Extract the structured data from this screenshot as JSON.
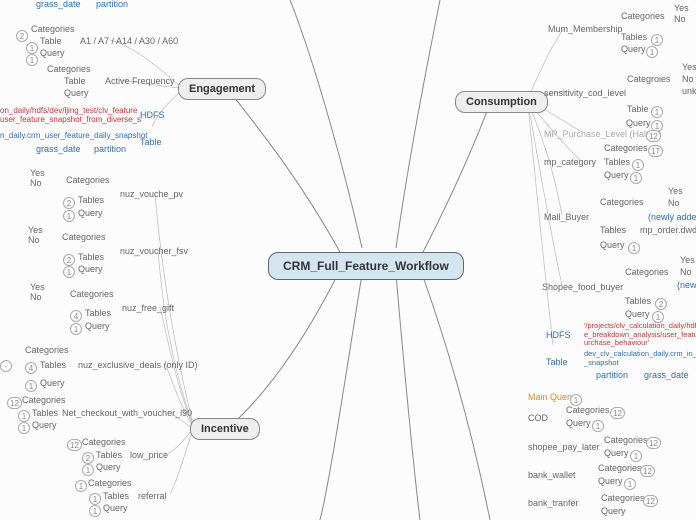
{
  "center": {
    "title": "CRM_Full_Feature_Workflow"
  },
  "left_top": {
    "grass_date": "grass_date",
    "partition": "partition",
    "categories_a": "Categories",
    "table_a": "Table",
    "query_a": "Query",
    "a_line": "A1 / A7 / A14 / A30 / A60",
    "categories_b": "Categories",
    "table_b": "Table",
    "query_b": "Query",
    "active_freq": "Active Frequency",
    "hdfs": "HDFS",
    "hdfs_path": "on_daily/hdfs/dev/ljing_test/clv_feature\nuser_feature_snapshot_from_diverse_s",
    "table_label": "Table",
    "table_path": "n_daily.crm_user_feature_daily_snapshot",
    "grass_date2": "grass_date",
    "partition2": "partition",
    "badge_2": "2",
    "badge_1a": "1",
    "badge_1b": "1"
  },
  "engagement": {
    "label": "Engagement"
  },
  "incentive": {
    "label": "Incentive"
  },
  "consumption": {
    "label": "Consumption"
  },
  "incentive_children": {
    "yes1": "Yes",
    "no1": "No",
    "cat1": "Categories",
    "tab1": "Tables",
    "q1": "Query",
    "b1a": "2",
    "b1b": "1",
    "node1": "nuz_vouche_pv",
    "yes2": "Yes",
    "no2": "No",
    "cat2": "Categories",
    "tab2": "Tables",
    "q2": "Query",
    "b2a": "2",
    "b2b": "1",
    "node2": "nuz_voucher_fsv",
    "yes3": "Yes",
    "no3": "No",
    "cat3": "Categories",
    "tab3": "Tables",
    "q3": "Query",
    "b3a": "4",
    "b3b": "1",
    "node3": "nuz_free_gift",
    "cat4": "Categories",
    "tab4": "Tables",
    "q4": "Query",
    "b4a": "4",
    "b4b": "1",
    "node4": "nuz_exclusive_deals (only ID)",
    "cat5": "Categories",
    "tab5": "Tables",
    "q5": "Query",
    "b5a": "12",
    "b5b": "1",
    "b5c": "1",
    "node5": "Net_checkout_with_voucher_l90",
    "cat6": "Categories",
    "tab6": "Tables",
    "q6": "Query",
    "b6a": "12",
    "b6b": "2",
    "b6c": "1",
    "node6": "low_price",
    "cat7": "Categories",
    "tab7": "Tables",
    "q7": "Query",
    "b7a": "1",
    "b7b": "1",
    "b7c": "1",
    "node7": "referral"
  },
  "consumption_children": {
    "mum": "Mum_Membership",
    "mum_cat": "Categories",
    "mum_tab": "Tables",
    "mum_q": "Query",
    "mum_yes": "Yes",
    "mum_no": "No",
    "mum_b1": "1",
    "mum_b2": "1",
    "scl": "sensitivity_cod_level",
    "scl_cat": "Categroies",
    "scl_tab": "Table",
    "scl_q": "Query",
    "scl_yes": "Yes",
    "scl_no": "No",
    "scl_unk": "unk",
    "scl_b1": "1",
    "scl_b2": "1",
    "halted": "MP_Purchase_Level (Halted)",
    "halted_b": "12",
    "mpcat": "mp_category",
    "mpcat_cat": "Categories",
    "mpcat_tab": "Tables",
    "mpcat_q": "Query",
    "mpcat_b1": "17",
    "mpcat_b2": "1",
    "mpcat_b3": "1",
    "mall": "Mall_Buyer",
    "mall_cat": "Categories",
    "mall_tab": "Tables",
    "mall_q": "Query",
    "mall_yes": "Yes",
    "mall_no": "No",
    "mall_new": "(newly added",
    "mall_tabval": "mp_order.dwd_orc",
    "mall_b": "1",
    "food": "Shopee_food_buyer",
    "food_cat": "Categories",
    "food_tab": "Tables",
    "food_q": "Query",
    "food_yes": "Yes",
    "food_no": "No",
    "food_new": "(new",
    "food_b1": "2",
    "food_b2": "1",
    "hdfs": "HDFS",
    "hdfs_path": "'/projects/clv_calculation_daily/hdfs/e\ne_breakdown_analysis/user_feature_sn\nurchase_behaviour'",
    "table": "Table",
    "table_path": "dev_clv_calculation_daily.crm_in_app_p\n_snapshot",
    "partition": "partition",
    "grass_date": "grass_date"
  },
  "bottom_right": {
    "main_query": "Main Query",
    "mq_b": "1",
    "cod": "COD",
    "cod_cat": "Categories",
    "cod_q": "Query",
    "cod_b1": "12",
    "cod_b2": "1",
    "spl": "shopee_pay_later",
    "spl_cat": "Categories",
    "spl_q": "Query",
    "spl_b1": "12",
    "spl_b2": "1",
    "bw": "bank_wallet",
    "bw_cat": "Categories",
    "bw_q": "Query",
    "bw_b1": "12",
    "bw_b2": "1",
    "bt": "bank_tranfer",
    "bt_cat": "Categories",
    "bt_q": "Query",
    "bt_b1": "12"
  }
}
